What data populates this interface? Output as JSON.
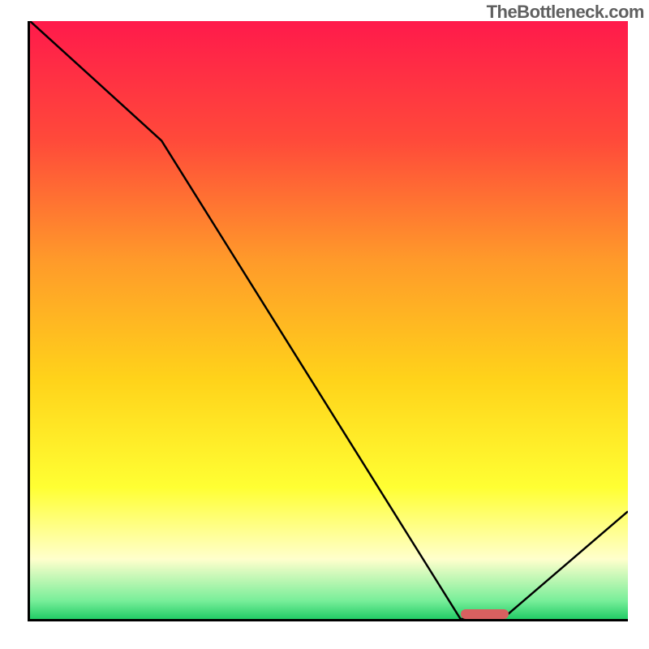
{
  "watermark": "TheBottleneck.com",
  "chart_data": {
    "type": "line",
    "title": "",
    "xlabel": "",
    "ylabel": "",
    "xlim": [
      0,
      100
    ],
    "ylim": [
      0,
      100
    ],
    "categories": [
      0,
      22,
      72,
      79,
      100
    ],
    "values": [
      100,
      80,
      0,
      0,
      18
    ],
    "optimal_range": {
      "x_start": 72,
      "x_end": 80,
      "y": 0
    },
    "gradient_stops": [
      {
        "offset": 0,
        "color": "#ff1a4b"
      },
      {
        "offset": 20,
        "color": "#ff4a3a"
      },
      {
        "offset": 40,
        "color": "#ff9a2a"
      },
      {
        "offset": 60,
        "color": "#ffd31a"
      },
      {
        "offset": 78,
        "color": "#ffff33"
      },
      {
        "offset": 90,
        "color": "#ffffcc"
      },
      {
        "offset": 97,
        "color": "#77ee99"
      },
      {
        "offset": 100,
        "color": "#22cc66"
      }
    ],
    "line_color": "#000000",
    "line_width": 2.5
  }
}
